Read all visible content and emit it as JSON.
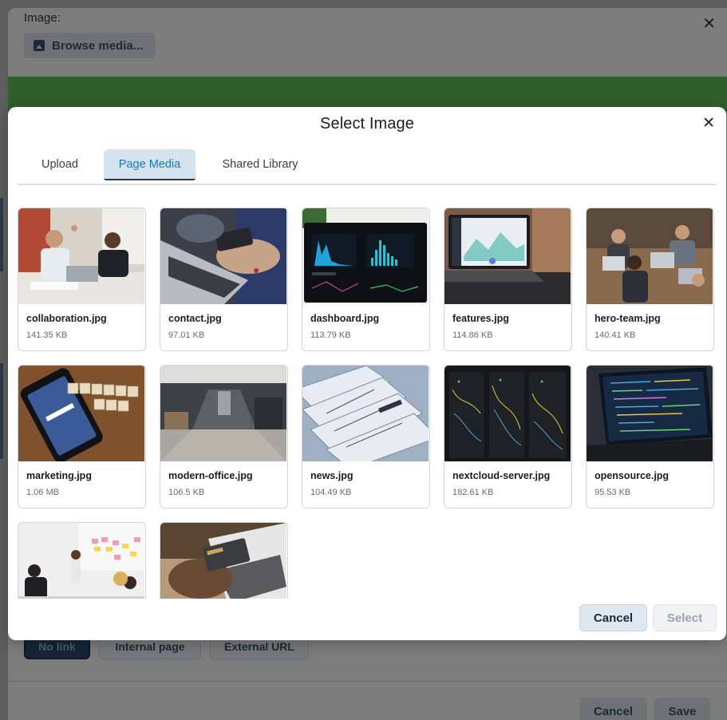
{
  "background": {
    "image_label": "Image:",
    "browse_label": "Browse media...",
    "close_glyph": "✕",
    "link_options": [
      "No link",
      "Internal page",
      "External URL"
    ],
    "cancel_label": "Cancel",
    "save_label": "Save"
  },
  "modal": {
    "title": "Select Image",
    "close_glyph": "✕",
    "tabs": [
      {
        "label": "Upload",
        "active": false
      },
      {
        "label": "Page Media",
        "active": true
      },
      {
        "label": "Shared Library",
        "active": false
      }
    ],
    "files": [
      {
        "name": "collaboration.jpg",
        "size": "141.35 KB",
        "thumb": "office-meeting"
      },
      {
        "name": "contact.jpg",
        "size": "97.01 KB",
        "thumb": "phone-laptop"
      },
      {
        "name": "dashboard.jpg",
        "size": "113.79 KB",
        "thumb": "dashboard-screen"
      },
      {
        "name": "features.jpg",
        "size": "114.86 KB",
        "thumb": "laptop-analytics"
      },
      {
        "name": "hero-team.jpg",
        "size": "140.41 KB",
        "thumb": "team-laptops"
      },
      {
        "name": "marketing.jpg",
        "size": "1.06 MB",
        "thumb": "social-media-phone"
      },
      {
        "name": "modern-office.jpg",
        "size": "106.5 KB",
        "thumb": "office-corridor"
      },
      {
        "name": "news.jpg",
        "size": "104.49 KB",
        "thumb": "newspapers"
      },
      {
        "name": "nextcloud-server.jpg",
        "size": "182.61 KB",
        "thumb": "server-rack"
      },
      {
        "name": "opensource.jpg",
        "size": "95.53 KB",
        "thumb": "code-laptop"
      },
      {
        "name": "",
        "size": "",
        "thumb": "sticky-notes-meeting"
      },
      {
        "name": "",
        "size": "",
        "thumb": "credit-card-laptop"
      }
    ],
    "cancel_label": "Cancel",
    "select_label": "Select"
  },
  "colors": {
    "accent": "#1679b8",
    "active_tab_bg": "#d5e3ef",
    "card_border": "#d4d4d4"
  }
}
